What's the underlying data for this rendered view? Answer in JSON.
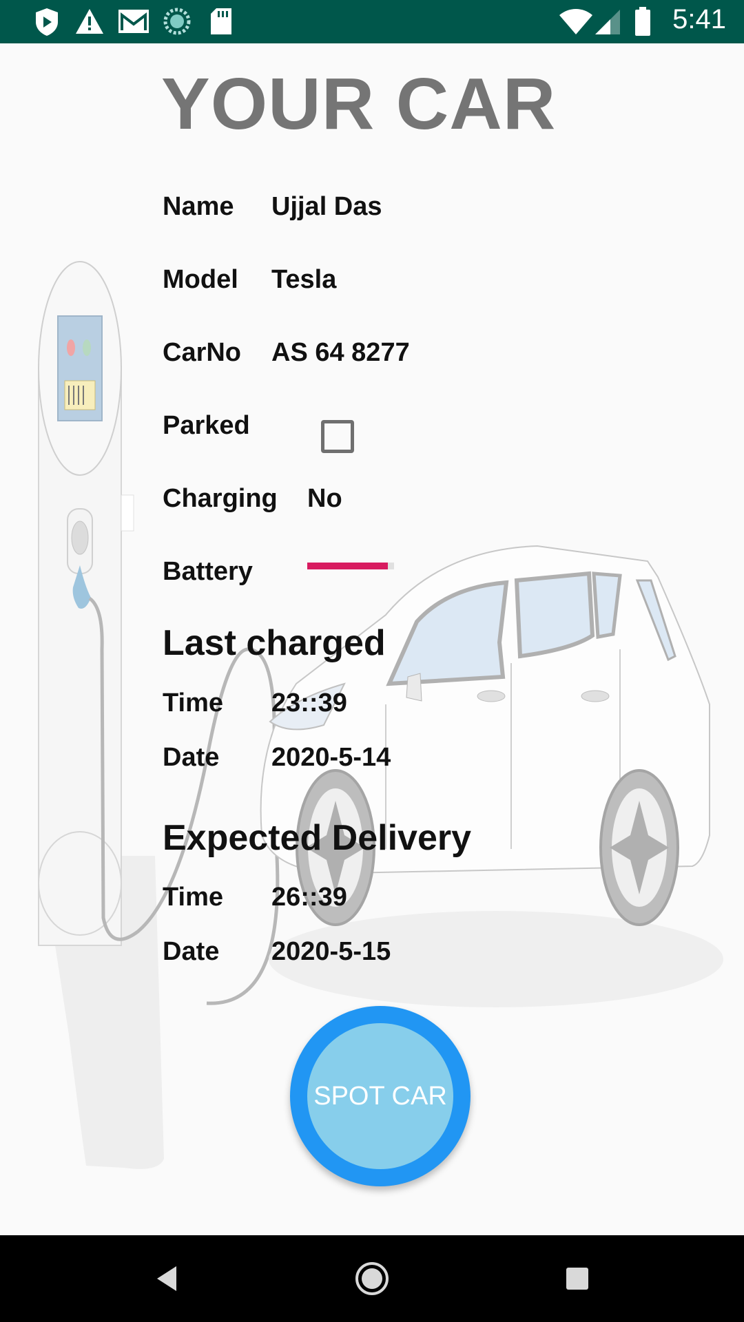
{
  "status_bar": {
    "time": "5:41",
    "left_icons": [
      "shield-icon",
      "warning-icon",
      "gmail-icon",
      "sync-icon",
      "sd-card-icon"
    ],
    "right_icons": [
      "wifi-icon",
      "signal-icon",
      "battery-icon"
    ]
  },
  "page": {
    "title": "YOUR CAR"
  },
  "details": {
    "name_label": "Name",
    "name_value": "Ujjal Das",
    "model_label": "Model",
    "model_value": "Tesla",
    "carno_label": "CarNo",
    "carno_value": "AS 64 8277",
    "parked_label": "Parked",
    "parked_checked": false,
    "charging_label": "Charging",
    "charging_value": "No",
    "battery_label": "Battery",
    "battery_level": 0.93,
    "battery_color": "#d81b60"
  },
  "last_charged": {
    "heading": "Last charged",
    "time_label": "Time",
    "time_value": "23::39",
    "date_label": "Date",
    "date_value": "2020-5-14"
  },
  "expected_delivery": {
    "heading": "Expected Delivery",
    "time_label": "Time",
    "time_value": "26::39",
    "date_label": "Date",
    "date_value": "2020-5-15"
  },
  "spot_button": {
    "label": "SPOT CAR",
    "outer_color": "#2196f3",
    "inner_color": "#87ceeb"
  },
  "nav_bar": {
    "buttons": [
      "back-icon",
      "home-icon",
      "recents-icon"
    ]
  },
  "colors": {
    "status_bar": "#00574b",
    "title": "#757575"
  }
}
